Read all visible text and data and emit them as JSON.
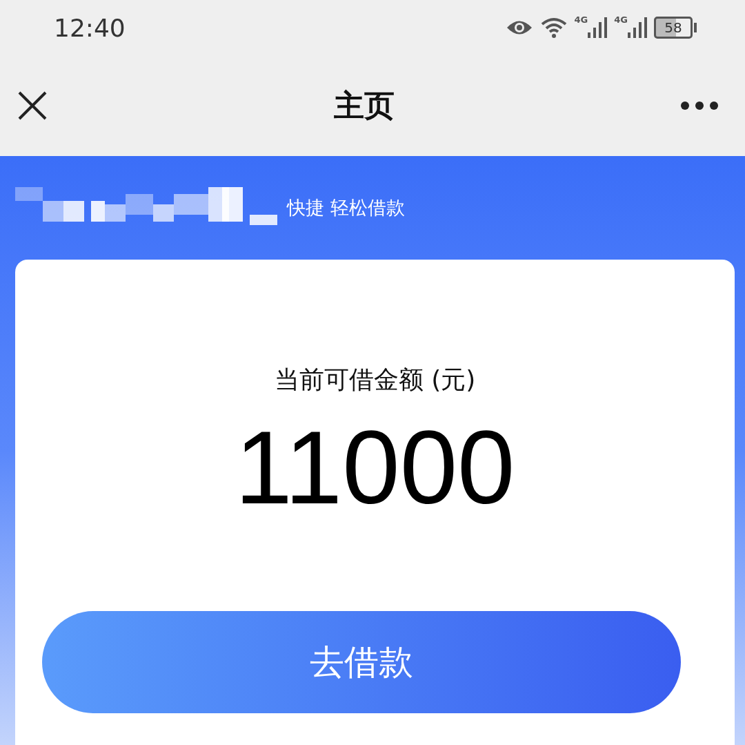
{
  "status_bar": {
    "time": "12:40",
    "network_labels": [
      "4G",
      "4G"
    ],
    "battery": "58"
  },
  "nav_bar": {
    "title": "主页"
  },
  "banner": {
    "slogan": "快捷 轻松借款"
  },
  "card": {
    "label": "当前可借金额 (元)",
    "amount": "11000"
  },
  "action_button": {
    "label": "去借款"
  }
}
